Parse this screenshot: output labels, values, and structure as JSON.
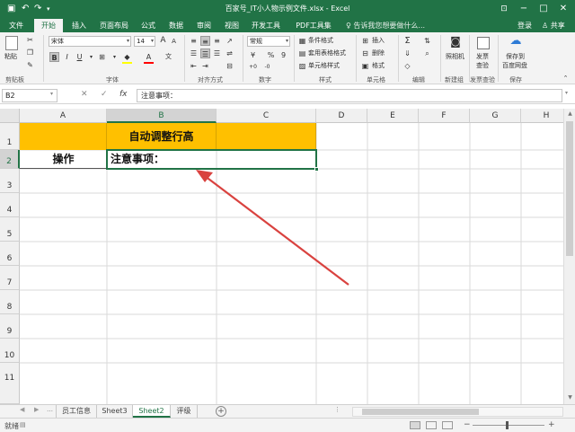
{
  "window": {
    "title": "百家号_IT小人物示例文件.xlsx - Excel",
    "quick_access": [
      "save-icon",
      "undo-icon",
      "redo-icon",
      "customize-icon"
    ]
  },
  "tabs": {
    "items": [
      "文件",
      "开始",
      "插入",
      "页面布局",
      "公式",
      "数据",
      "审阅",
      "视图",
      "开发工具",
      "PDF工具集"
    ],
    "active": "开始",
    "tell_me": "♀ 告诉我您想要做什么...",
    "login": "登录",
    "share": "♙ 共享"
  },
  "ribbon": {
    "clipboard": {
      "paste": "粘贴",
      "label": "剪贴板"
    },
    "font": {
      "name": "宋体",
      "size": "14",
      "bold": "B",
      "italic": "I",
      "underline": "U",
      "grow": "A",
      "shrink": "A",
      "label": "字体",
      "fill_color": "#ffff00",
      "font_color": "#ff0000"
    },
    "alignment": {
      "label": "对齐方式"
    },
    "number": {
      "format": "常规",
      "currency": "¥",
      "percent": "%",
      "comma": "9",
      "label": "数字"
    },
    "styles": {
      "conditional": "条件格式",
      "table": "套用表格格式",
      "cell": "单元格样式",
      "label": "样式"
    },
    "cells": {
      "insert": "插入",
      "delete": "删除",
      "format": "格式",
      "label": "单元格"
    },
    "editing": {
      "label": "编辑"
    },
    "camera": {
      "line1": "照相机",
      "label": "新建组"
    },
    "invoice": {
      "line1": "发票",
      "line2": "查验",
      "label": "发票查验"
    },
    "save": {
      "line1": "保存到",
      "line2": "百度网盘",
      "label": "保存"
    }
  },
  "formula_bar": {
    "name_box": "B2",
    "cancel": "✕",
    "enter": "✓",
    "fx": "fx",
    "value": "注意事项："
  },
  "sheet": {
    "columns": [
      "A",
      "B",
      "C",
      "D",
      "E",
      "F",
      "G",
      "H"
    ],
    "selected_column": "B",
    "rows": [
      "1",
      "2",
      "3",
      "4",
      "5",
      "6",
      "7",
      "8",
      "9",
      "10",
      "11"
    ],
    "selected_row": "2",
    "cells": {
      "B1": "自动调整行高",
      "A2": "操作",
      "B2": "注意事项："
    },
    "fill_color": "#ffc000",
    "arrow_color": "#d9423f"
  },
  "sheet_tabs": {
    "items": [
      "员工信息",
      "Sheet3",
      "Sheet2",
      "评级"
    ],
    "active": "Sheet2"
  },
  "status": {
    "ready": "就绪"
  }
}
